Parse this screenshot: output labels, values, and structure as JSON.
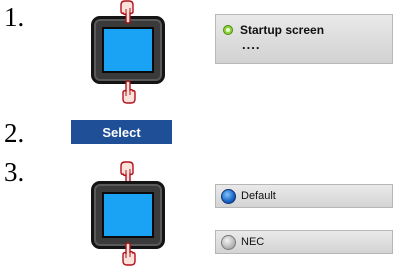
{
  "steps": {
    "step1": "1.",
    "step2": "2.",
    "step3": "3."
  },
  "startup_panel": {
    "title": "Startup screen",
    "value": "...."
  },
  "select_button": {
    "label": "Select",
    "color": "#1f4f97"
  },
  "options": [
    {
      "label": "Default",
      "selected": true
    },
    {
      "label": "NEC",
      "selected": false
    }
  ],
  "icons": {
    "hand": "pointing-hand-icon",
    "screen": "device-screen-icon",
    "status": "green-status-dot-icon",
    "radio_on": "radio-selected-icon",
    "radio_off": "radio-unselected-icon"
  },
  "colors": {
    "screen": "#1aa3f4",
    "status_dot": "#8fd33a"
  }
}
